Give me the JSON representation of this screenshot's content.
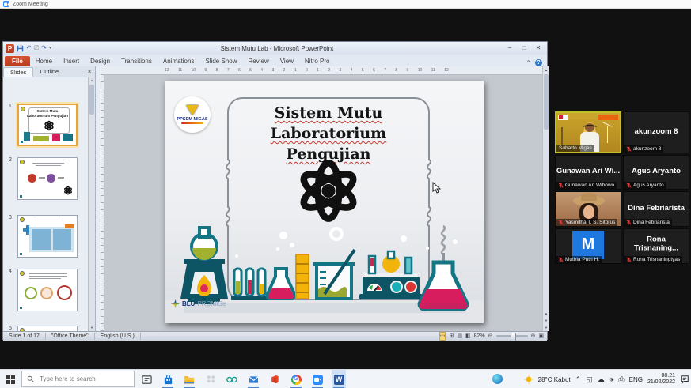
{
  "zoom_meeting": {
    "window_title": "Zoom Meeting"
  },
  "powerpoint": {
    "window_title": "Sistem Mutu Lab - Microsoft PowerPoint",
    "ribbon_tabs": [
      "File",
      "Home",
      "Insert",
      "Design",
      "Transitions",
      "Animations",
      "Slide Show",
      "Review",
      "View",
      "Nitro Pro"
    ],
    "panel_tabs": [
      "Slides",
      "Outline"
    ],
    "ruler_numbers": "12 11 10 9 8 7 6 5 4 3 2 1 0 1 2 3 4 5 6 7 8 9 10 11 12",
    "thumbnails": [
      {
        "number": "1"
      },
      {
        "number": "2"
      },
      {
        "number": "3"
      },
      {
        "number": "4"
      },
      {
        "number": "5"
      }
    ],
    "slide": {
      "title_line1": "Sistem Mutu",
      "title_line2": "Laboratorium Pengujian",
      "logo_text": "PPSDM MIGAS",
      "footer_brand_bold": "BLU",
      "footer_brand_light": "PROMISe"
    },
    "status_bar": {
      "slide_indicator": "Slide 1 of 17",
      "theme": "\"Office Theme\"",
      "language": "English (U.S.)",
      "zoom_level": "82%"
    }
  },
  "participants": [
    {
      "label": "Suharto Migas",
      "type": "video"
    },
    {
      "display_name": "akunzoom 8",
      "label": "akunzoom 8"
    },
    {
      "display_name": "Gunawan Ari Wi...",
      "label": "Gunawan Ari Wibowo"
    },
    {
      "display_name": "Agus Aryanto",
      "label": "Agus Aryanto"
    },
    {
      "label": "Yasmitha T. S. Sitorus",
      "type": "video"
    },
    {
      "display_name": "Dina Febriarista",
      "label": "Dina Febriarista"
    },
    {
      "avatar_letter": "M",
      "label": "Muthia Putri H."
    },
    {
      "display_name": "Rona Trisnaning...",
      "label": "Rona Trisnaningtyas"
    }
  ],
  "taskbar": {
    "search_placeholder": "Type here to search",
    "weather": "28°C  Kabut",
    "language": "ENG",
    "time": "08.21",
    "date": "21/02/2022"
  }
}
